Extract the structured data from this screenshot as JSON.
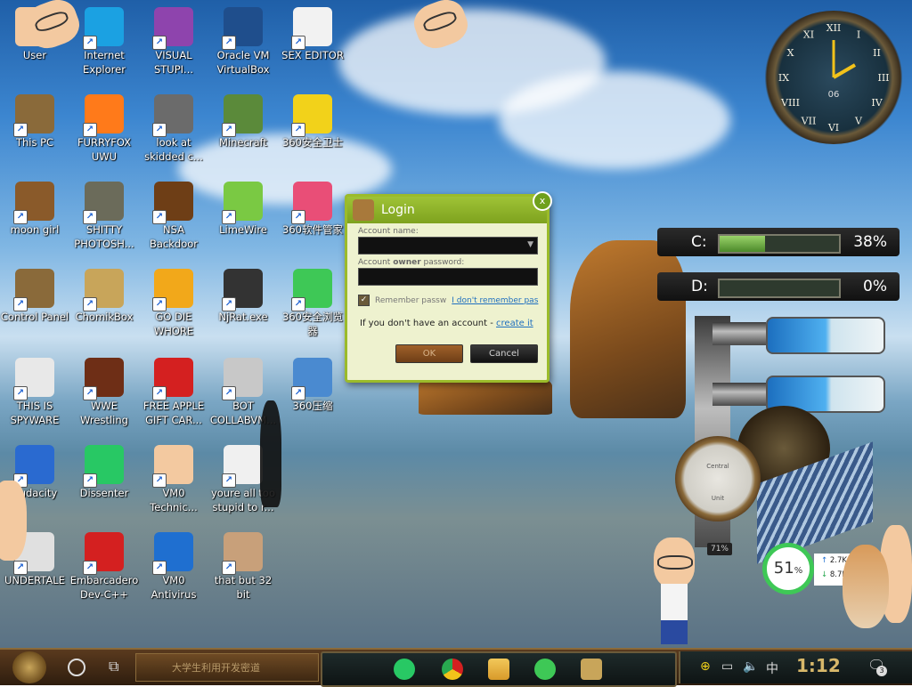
{
  "desktop_icons": [
    {
      "label": "User",
      "icon": "user-face-icon",
      "color": "#f3c9a0"
    },
    {
      "label": "Internet Explorer",
      "icon": "edge-browser-icon",
      "color": "#1ba1e2"
    },
    {
      "label": "VISUAL STUPI...",
      "icon": "visual-studio-icon",
      "color": "#8e44ad"
    },
    {
      "label": "Oracle VM VirtualBox",
      "icon": "virtualbox-icon",
      "color": "#1f4e8c"
    },
    {
      "label": "SEX EDITOR",
      "icon": "hex-editor-icon",
      "color": "#f2f2f2"
    },
    {
      "label": "This PC",
      "icon": "computer-icon",
      "color": "#8a6a3a"
    },
    {
      "label": "FURRYFOX UWU",
      "icon": "firefox-icon",
      "color": "#ff7a1a"
    },
    {
      "label": "look at skidded c...",
      "icon": "stack-windows-icon",
      "color": "#6b6b6b"
    },
    {
      "label": "Minecraft",
      "icon": "minecraft-block-icon",
      "color": "#5b8a3a"
    },
    {
      "label": "360安全卫士",
      "icon": "security-plus-icon",
      "color": "#f2d21a"
    },
    {
      "label": "moon girl",
      "icon": "book-icon",
      "color": "#8a5a2a"
    },
    {
      "label": "SHITTY PHOTOSH...",
      "icon": "gimp-icon",
      "color": "#6b6b5a"
    },
    {
      "label": "NSA Backdoor",
      "icon": "wood-box-icon",
      "color": "#6e3e16"
    },
    {
      "label": "LimeWire",
      "icon": "limewire-icon",
      "color": "#7ac943"
    },
    {
      "label": "360软件管家",
      "icon": "flower-icon",
      "color": "#e94e77"
    },
    {
      "label": "Control Panel",
      "icon": "lamp-icon",
      "color": "#8a6a3a"
    },
    {
      "label": "ChomikBox",
      "icon": "hamster-box-icon",
      "color": "#c8a55a"
    },
    {
      "label": "GO DIE WHORE",
      "icon": "adobe-de-icon",
      "color": "#f2a81a"
    },
    {
      "label": "NjRat.exe",
      "icon": "skull-icon",
      "color": "#333333"
    },
    {
      "label": "360安全浏览器",
      "icon": "360-browser-icon",
      "color": "#3ec856"
    },
    {
      "label": "THIS IS SPYWARE",
      "icon": "chrome-icon",
      "color": "#e8e8e8"
    },
    {
      "label": "WWE Wrestling",
      "icon": "wrestling-box-icon",
      "color": "#6e2e16"
    },
    {
      "label": "FREE APPLE GIFT CAR...",
      "icon": "apple-icon",
      "color": "#d42020"
    },
    {
      "label": "BOT COLLABVM...",
      "icon": "monitor-icon",
      "color": "#c8c8c8"
    },
    {
      "label": "360压缩",
      "icon": "zip-archive-icon",
      "color": "#4a8ad0"
    },
    {
      "label": "Audacity",
      "icon": "audacity-icon",
      "color": "#2a6ad0"
    },
    {
      "label": "Dissenter",
      "icon": "chat-bubble-icon",
      "color": "#28c864"
    },
    {
      "label": "VM0 Technic...",
      "icon": "technician-icon",
      "color": "#f3c9a0"
    },
    {
      "label": "youre all too stupid to r...",
      "icon": "portrait-icon",
      "color": "#f0f0f0"
    },
    {
      "label": "UNDERTALE",
      "icon": "unity-icon",
      "color": "#e0e0e0"
    },
    {
      "label": "Embarcadero Dev-C++",
      "icon": "devcpp-icon",
      "color": "#d42020"
    },
    {
      "label": "VM0 Antivirus",
      "icon": "shield-icon",
      "color": "#1f6fd0"
    },
    {
      "label": "that but 32 bit",
      "icon": "portrait-icon",
      "color": "#c8a07a"
    }
  ],
  "login_dialog": {
    "title": "Login",
    "account_name_label": "Account name:",
    "password_label_pre": "Account ",
    "password_label_bold": "owner",
    "password_label_post": " password:",
    "remember_label": "Remember passw",
    "forgot_link": "I don't remember pas",
    "no_account_text": "If you don't have an account - ",
    "create_link": "create it",
    "ok_label": "OK",
    "cancel_label": "Cancel",
    "close_symbol": "x"
  },
  "clock_widget": {
    "day": "06",
    "numerals": [
      "XII",
      "I",
      "II",
      "III",
      "IV",
      "V",
      "VI",
      "VII",
      "VIII",
      "IX",
      "X",
      "XI"
    ]
  },
  "drives": [
    {
      "label": "C:",
      "percent_text": "38%",
      "fill": 0.38
    },
    {
      "label": "D:",
      "percent_text": "0%",
      "fill": 0.0
    }
  ],
  "gauge": {
    "line1": "Central",
    "line2": "Unit",
    "readout": "71%"
  },
  "network_widget": {
    "cpu_percent": "51",
    "unit": "%",
    "upload": "2.7K/s",
    "download": "8.7K/s",
    "up_arrow": "↑",
    "down_arrow": "↓",
    "plus": "+"
  },
  "taskbar": {
    "search_placeholder": "大学生利用开发密道",
    "clock": "1:12",
    "ime": "中",
    "notification_count": "3"
  },
  "colors": {
    "accent": "#9bbb2a",
    "taskbar": "#3e2812",
    "clock_text": "#d8b86a"
  }
}
